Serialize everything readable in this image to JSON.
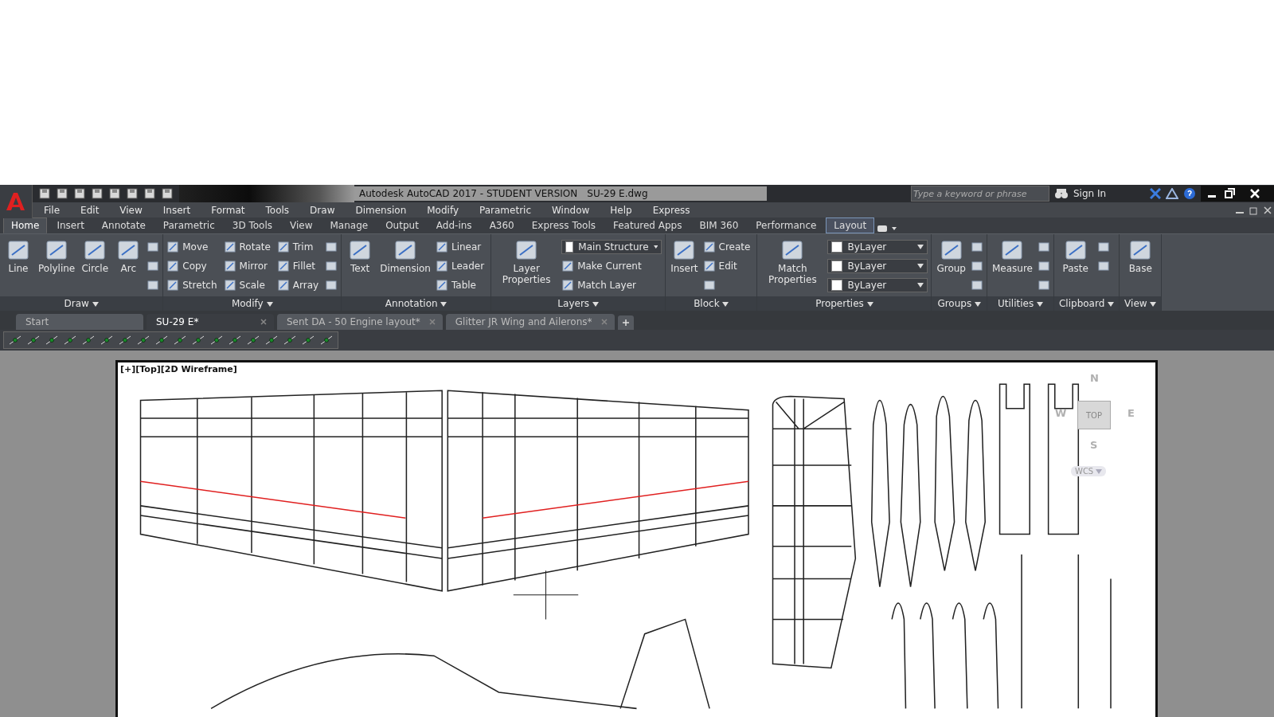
{
  "title_bar": {
    "app_title": "Autodesk AutoCAD 2017 - STUDENT VERSION",
    "file_name": "SU-29 E.dwg",
    "search": {
      "placeholder": "Type a keyword or phrase"
    },
    "sign_in": "Sign In"
  },
  "menu": [
    "File",
    "Edit",
    "View",
    "Insert",
    "Format",
    "Tools",
    "Draw",
    "Dimension",
    "Modify",
    "Parametric",
    "Window",
    "Help",
    "Express"
  ],
  "ribbon_tabs": [
    {
      "label": "Home",
      "selected": true,
      "kind": "standard"
    },
    {
      "label": "Insert",
      "selected": false,
      "kind": "standard"
    },
    {
      "label": "Annotate",
      "selected": false,
      "kind": "standard"
    },
    {
      "label": "Parametric",
      "selected": false,
      "kind": "standard"
    },
    {
      "label": "3D Tools",
      "selected": false,
      "kind": "standard"
    },
    {
      "label": "View",
      "selected": false,
      "kind": "standard"
    },
    {
      "label": "Manage",
      "selected": false,
      "kind": "standard"
    },
    {
      "label": "Output",
      "selected": false,
      "kind": "standard"
    },
    {
      "label": "Add-ins",
      "selected": false,
      "kind": "standard"
    },
    {
      "label": "A360",
      "selected": false,
      "kind": "standard"
    },
    {
      "label": "Express Tools",
      "selected": false,
      "kind": "standard"
    },
    {
      "label": "Featured Apps",
      "selected": false,
      "kind": "standard"
    },
    {
      "label": "BIM 360",
      "selected": false,
      "kind": "standard"
    },
    {
      "label": "Performance",
      "selected": false,
      "kind": "standard"
    },
    {
      "label": "Layout",
      "selected": false,
      "kind": "contextual"
    }
  ],
  "panels": [
    {
      "title": "Draw",
      "tools": [
        {
          "label": "Line",
          "kind": "large"
        },
        {
          "label": "Polyline",
          "kind": "large"
        },
        {
          "label": "Circle",
          "kind": "large"
        },
        {
          "label": "Arc",
          "kind": "large"
        },
        {
          "kind": "icon"
        },
        {
          "kind": "icon"
        },
        {
          "kind": "icon"
        }
      ]
    },
    {
      "title": "Modify",
      "tools": [
        {
          "label": "Move",
          "kind": "small"
        },
        {
          "label": "Copy",
          "kind": "small"
        },
        {
          "label": "Stretch",
          "kind": "small"
        },
        {
          "label": "Rotate",
          "kind": "small"
        },
        {
          "label": "Mirror",
          "kind": "small"
        },
        {
          "label": "Scale",
          "kind": "small"
        },
        {
          "label": "Trim",
          "kind": "small"
        },
        {
          "label": "Fillet",
          "kind": "small"
        },
        {
          "label": "Array",
          "kind": "small"
        },
        {
          "kind": "icon"
        },
        {
          "kind": "icon"
        },
        {
          "kind": "icon"
        }
      ]
    },
    {
      "title": "Annotation",
      "tools": [
        {
          "label": "Text",
          "kind": "large"
        },
        {
          "label": "Dimension",
          "kind": "large"
        },
        {
          "label": "Linear",
          "kind": "small"
        },
        {
          "label": "Leader",
          "kind": "small"
        },
        {
          "label": "Table",
          "kind": "small"
        }
      ]
    },
    {
      "title": "Layers",
      "tools": [
        {
          "label": "Layer Properties",
          "kind": "large"
        },
        {
          "label": "Main Structure",
          "kind": "dropdown"
        },
        {
          "label": "Make Current",
          "kind": "small"
        },
        {
          "label": "Match Layer",
          "kind": "small"
        }
      ]
    },
    {
      "title": "Block",
      "tools": [
        {
          "label": "Insert",
          "kind": "large"
        },
        {
          "label": "Create",
          "kind": "small"
        },
        {
          "label": "Edit",
          "kind": "small"
        },
        {
          "kind": "icon"
        }
      ]
    },
    {
      "title": "Properties",
      "tools": [
        {
          "label": "Match Properties",
          "kind": "large"
        },
        {
          "label": "ByLayer",
          "kind": "dropdown"
        },
        {
          "label": "ByLayer",
          "kind": "dropdown"
        },
        {
          "label": "ByLayer",
          "kind": "dropdown"
        }
      ]
    },
    {
      "title": "Groups",
      "tools": [
        {
          "label": "Group",
          "kind": "large"
        },
        {
          "kind": "icon"
        },
        {
          "kind": "icon"
        },
        {
          "kind": "icon"
        }
      ]
    },
    {
      "title": "Utilities",
      "tools": [
        {
          "label": "Measure",
          "kind": "large"
        },
        {
          "kind": "icon"
        },
        {
          "kind": "icon"
        },
        {
          "kind": "icon"
        }
      ]
    },
    {
      "title": "Clipboard",
      "tools": [
        {
          "label": "Paste",
          "kind": "large"
        },
        {
          "kind": "icon"
        },
        {
          "kind": "icon"
        }
      ]
    },
    {
      "title": "View",
      "tools": [
        {
          "label": "Base",
          "kind": "large"
        }
      ]
    }
  ],
  "file_tabs": [
    {
      "label": "Start",
      "selected": false,
      "closable": false
    },
    {
      "label": "SU-29 E*",
      "selected": true,
      "closable": true
    },
    {
      "label": "Sent DA - 50 Engine layout*",
      "selected": false,
      "closable": true
    },
    {
      "label": "Glitter JR Wing and Ailerons*",
      "selected": false,
      "closable": true
    }
  ],
  "viewport": {
    "label": "[+][Top][2D Wireframe]",
    "viewcube": {
      "north": "N",
      "east": "E",
      "south": "S",
      "west": "W",
      "face": "TOP",
      "ucs": "WCS"
    }
  }
}
